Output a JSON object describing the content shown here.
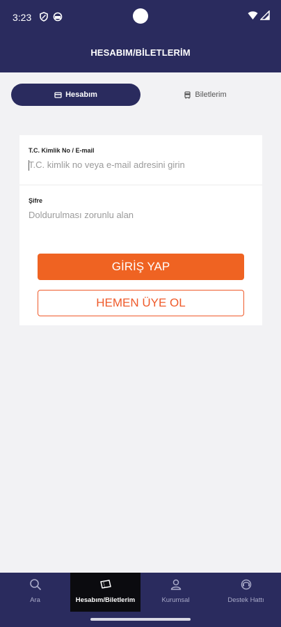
{
  "status_bar": {
    "time": "3:23",
    "icons": [
      "shield-icon",
      "vpn-icon",
      "wifi-icon",
      "signal-icon"
    ]
  },
  "app_bar": {
    "title": "HESABIM/BİLETLERİM"
  },
  "tabs": [
    {
      "label": "Hesabım",
      "icon": "card-icon",
      "active": true
    },
    {
      "label": "Biletlerim",
      "icon": "bus-icon",
      "active": false
    }
  ],
  "form": {
    "id_field": {
      "label": "T.C. Kimlik No / E-mail",
      "placeholder": "T.C. kimlik no veya e-mail adresini girin",
      "value": ""
    },
    "password_field": {
      "label": "Şifre",
      "placeholder": "Doldurulması zorunlu alan",
      "value": ""
    },
    "login_button": "GİRİŞ YAP",
    "register_button": "HEMEN ÜYE OL"
  },
  "bottom_nav": [
    {
      "label": "Ara",
      "icon": "search-icon",
      "active": false
    },
    {
      "label": "Hesabım/Biletlerim",
      "icon": "ticket-icon",
      "active": true
    },
    {
      "label": "Kurumsal",
      "icon": "person-icon",
      "active": false
    },
    {
      "label": "Destek Hattı",
      "icon": "support-icon",
      "active": false
    }
  ],
  "colors": {
    "primary_navy": "#2a2b5e",
    "accent_orange": "#ef6322",
    "background": "#f2f2f4"
  }
}
